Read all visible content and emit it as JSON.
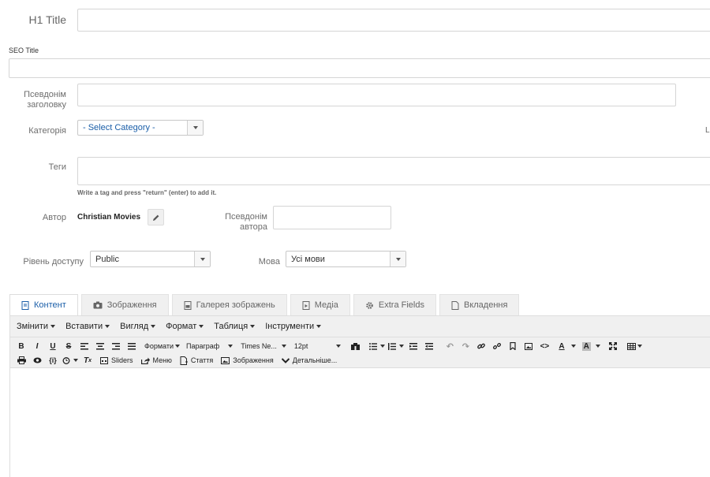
{
  "form": {
    "h1_title_label": "H1 Title",
    "h1_title_value": "",
    "seo_title_label": "SEO Title",
    "seo_title_value": "",
    "alias_label_1": "Псевдонім",
    "alias_label_2": "заголовку",
    "alias_value": "",
    "category_label": "Категорія",
    "category_value": "- Select Category -",
    "right_edge_letter": "L",
    "tags_label": "Теги",
    "tags_value": "",
    "tags_hint": "Write a tag and press \"return\" (enter) to add it.",
    "author_label": "Автор",
    "author_name": "Christian Movies",
    "author_alias_label_1": "Псевдонім",
    "author_alias_label_2": "автора",
    "author_alias_value": "",
    "access_label": "Рівень доступу",
    "access_value": "Public",
    "language_label": "Мова",
    "language_value": "Усі мови"
  },
  "tabs": [
    {
      "label": "Контент",
      "icon": "document-icon",
      "active": true
    },
    {
      "label": "Зображення",
      "icon": "camera-icon"
    },
    {
      "label": "Галерея зображень",
      "icon": "image-file-icon"
    },
    {
      "label": "Медіа",
      "icon": "media-file-icon"
    },
    {
      "label": "Extra Fields",
      "icon": "gear-icon"
    },
    {
      "label": "Вкладення",
      "icon": "file-icon"
    }
  ],
  "editor": {
    "menu": [
      "Змінити",
      "Вставити",
      "Вигляд",
      "Формат",
      "Таблиця",
      "Інструменти"
    ],
    "formats_label": "Формати",
    "paragraph_label": "Параграф",
    "font_label": "Times Ne...",
    "size_label": "12pt",
    "sliders_label": "Sliders",
    "menu_btn_label": "Меню",
    "article_label": "Стаття",
    "image_label": "Зображення",
    "more_label": "Детальніше...",
    "brace_label": "{i}",
    "content": ""
  },
  "colors": {
    "accent": "#1a5ea8",
    "border": "#d5d5d5",
    "toolbar_bg": "#f0f0f0"
  }
}
